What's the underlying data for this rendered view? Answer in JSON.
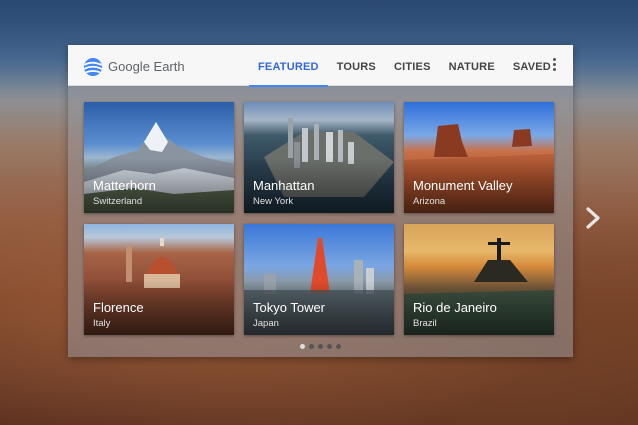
{
  "app": {
    "brand": "Google Earth"
  },
  "tabs": [
    {
      "label": "FEATURED",
      "active": true
    },
    {
      "label": "TOURS",
      "active": false
    },
    {
      "label": "CITIES",
      "active": false
    },
    {
      "label": "NATURE",
      "active": false
    },
    {
      "label": "SAVED",
      "active": false
    }
  ],
  "cards": [
    {
      "title": "Matterhorn",
      "subtitle": "Switzerland"
    },
    {
      "title": "Manhattan",
      "subtitle": "New York"
    },
    {
      "title": "Monument Valley",
      "subtitle": "Arizona"
    },
    {
      "title": "Florence",
      "subtitle": "Italy"
    },
    {
      "title": "Tokyo Tower",
      "subtitle": "Japan"
    },
    {
      "title": "Rio de Janeiro",
      "subtitle": "Brazil"
    }
  ],
  "pager": {
    "pages": 5,
    "current": 1
  },
  "icons": {
    "logo": "google-earth-logo-icon",
    "menu": "more-vert-icon",
    "next": "chevron-right-icon"
  },
  "colors": {
    "accent": "#4285f4",
    "active_tab_text": "#3367d6"
  }
}
